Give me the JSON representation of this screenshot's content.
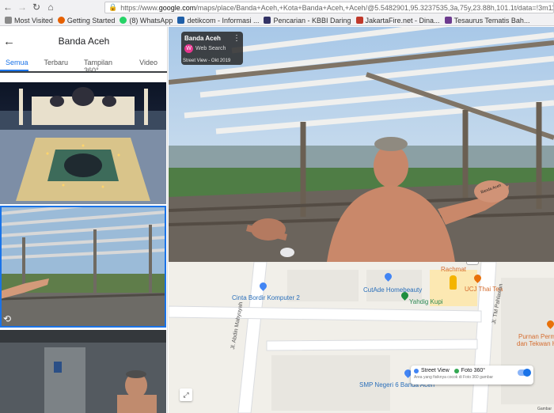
{
  "browser": {
    "url_prefix": "https://www.",
    "url_domain": "google.com",
    "url_rest": "/maps/place/Banda+Aceh,+Kota+Banda+Aceh,+Aceh/@5.5482901,95.3237535,3a,75y,23.88h,101.1t/data=!3m11!1e1!3m9!1e1",
    "bookmarks": [
      {
        "label": "Most Visited",
        "color": "#8a8a8a"
      },
      {
        "label": "Getting Started",
        "color": "#e66000"
      },
      {
        "label": "(8) WhatsApp",
        "color": "#25d366"
      },
      {
        "label": "detikcom - Informasi ...",
        "color": "#1f5fa8"
      },
      {
        "label": "Pencarian - KBBI Daring",
        "color": "#333366"
      },
      {
        "label": "JakartaFire.net - Dina...",
        "color": "#c0392b"
      },
      {
        "label": "Tesaurus Tematis Bah...",
        "color": "#6d3b8f"
      }
    ]
  },
  "panel": {
    "title": "Banda Aceh",
    "tabs": [
      "Semua",
      "Terbaru",
      "Tampilan 360°",
      "Video"
    ],
    "active_tab": 0
  },
  "streetview": {
    "place": "Banda Aceh",
    "source": "Web Search",
    "captured": "Street View - Okt 2019",
    "hand_text": "Banda Aceh"
  },
  "map": {
    "labels": [
      {
        "text": "Cinta Bordir Komputer 2",
        "cls": "blue"
      },
      {
        "text": "CutAde Homebeauty",
        "cls": "blue"
      },
      {
        "text": "Yahdig Kupi",
        "cls": "green"
      },
      {
        "text": "Rachmat",
        "cls": "orange"
      },
      {
        "text": "UCJ Thai Tea",
        "cls": "orange"
      },
      {
        "text": "SMP Negeri 6 Banda Aceh",
        "cls": "blue"
      },
      {
        "text": "Jl. Abdin Mahyuyah",
        "cls": "road"
      },
      {
        "text": "Jl. TM Pahlawan",
        "cls": "road"
      },
      {
        "text": "Purnan Perm",
        "cls": "orange"
      },
      {
        "text": "dan Tekwan Ha",
        "cls": "orange"
      }
    ],
    "chip_street_view": "Street View",
    "chip_photo": "Foto 360°",
    "chip_sub": "Area yang fisiknya cocok di Foto 360 gambar",
    "attribution": "Gambar"
  }
}
